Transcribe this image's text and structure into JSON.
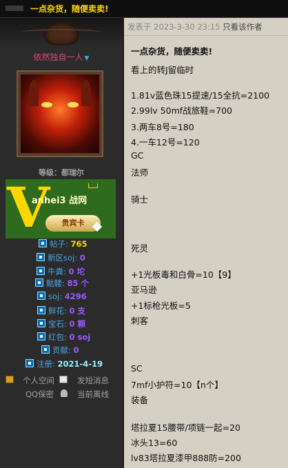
{
  "top_bar": {
    "thread_title": "一点杂货，随便卖卖!"
  },
  "profile": {
    "username": "依然独自一人",
    "level": "等级：都瑞尔",
    "banner": {
      "letter": "V",
      "site": "anhei3 战网",
      "card": "贵宾卡"
    },
    "stats": [
      {
        "label": "帖子:",
        "value": "765",
        "color": "#ffd700"
      },
      {
        "label": "新区soj:",
        "value": "0",
        "color": "#9b59ff"
      },
      {
        "label": "牛粪:",
        "value": "0 坨",
        "color": "#9b59ff"
      },
      {
        "label": "骷髅:",
        "value": "85 个",
        "color": "#9b59ff"
      },
      {
        "label": "soj:",
        "value": "4296",
        "color": "#9b59ff"
      },
      {
        "label": "鲜花:",
        "value": "0 支",
        "color": "#9b59ff"
      },
      {
        "label": "宝石:",
        "value": "0 颗",
        "color": "#9b59ff"
      },
      {
        "label": "红包:",
        "value": "0 soj",
        "color": "#9b59ff"
      },
      {
        "label": "贡献:",
        "value": "0",
        "color": "#9b59ff"
      },
      {
        "label": "注册:",
        "value": "2021-4-19",
        "color": "#9bf0ff"
      }
    ],
    "links": {
      "space": "个人空间",
      "message": "发短消息",
      "qq": "QQ保密",
      "status": "当前离线"
    }
  },
  "post": {
    "posted_label": "发表于 2023-3-30 23:15",
    "author_only": "只看该作者",
    "lines": [
      "一点杂货，随便卖卖!",
      "看上的转J留临时",
      "",
      "1.81v蓝色珠15提速/15全抗=2100",
      "2.99lv 50mf战旅鞋=700",
      "3.两车8号=180",
      "4.一车12号=120",
      "GC",
      "法师",
      "",
      "骑士",
      "",
      "",
      "死灵",
      "",
      "+1光板毒和白骨=10【9】",
      "亚马逊",
      "+1标枪光板=5",
      "刺客",
      "",
      "",
      "",
      "SC",
      "7mf小护符=10【n个】",
      "装备",
      "",
      "塔拉夏15腰带/项链一起=20",
      "冰头13=60",
      "lv83塔拉夏漆甲888防=200"
    ]
  },
  "colors": {
    "username": "#e0457b",
    "accent": "#4aa3df",
    "title": "#ffd700"
  }
}
